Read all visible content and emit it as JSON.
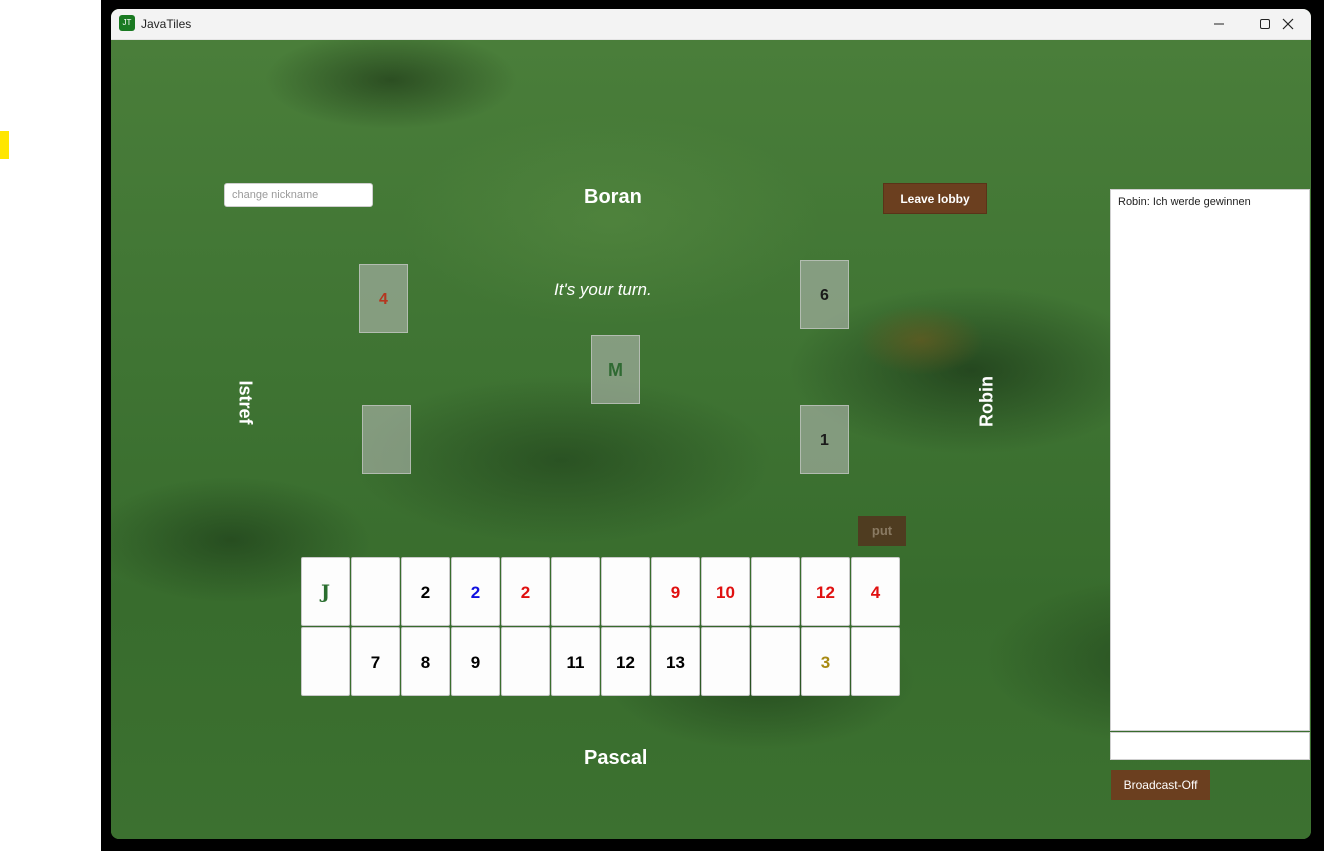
{
  "window": {
    "title": "JavaTiles",
    "icon_text": "JT",
    "icon": "app-icon"
  },
  "controls": {
    "minimize": "minimize-icon",
    "maximize": "maximize-icon",
    "close": "close-icon"
  },
  "lobby": {
    "nickname_placeholder": "change nickname",
    "leave_label": "Leave lobby",
    "turn_message": "It's your turn.",
    "put_label": "put",
    "broadcast_label": "Broadcast-Off"
  },
  "players": {
    "top": "Boran",
    "left": "Istref",
    "right": "Robin",
    "bottom": "Pascal"
  },
  "stacks": {
    "top_left": {
      "value": "4",
      "color": "#b5361f"
    },
    "top_right": {
      "value": "6",
      "color": "#1a1a1a"
    },
    "center": {
      "value": "M",
      "color": "#2f6a32"
    },
    "bottom_left": {
      "value": "",
      "color": "#1a1a1a"
    },
    "bottom_right": {
      "value": "1",
      "color": "#1a1a1a"
    }
  },
  "rack": {
    "row1": [
      {
        "value": "J",
        "color": "#2a6e2f"
      },
      {
        "value": "",
        "color": "#000000"
      },
      {
        "value": "2",
        "color": "#000000"
      },
      {
        "value": "2",
        "color": "#1010e0"
      },
      {
        "value": "2",
        "color": "#e01010"
      },
      {
        "value": "",
        "color": "#000000"
      },
      {
        "value": "",
        "color": "#000000"
      },
      {
        "value": "9",
        "color": "#e01010"
      },
      {
        "value": "10",
        "color": "#e01010"
      },
      {
        "value": "",
        "color": "#000000"
      },
      {
        "value": "12",
        "color": "#e01010"
      },
      {
        "value": "4",
        "color": "#e01010"
      }
    ],
    "row2": [
      {
        "value": "",
        "color": "#000000"
      },
      {
        "value": "7",
        "color": "#000000"
      },
      {
        "value": "8",
        "color": "#000000"
      },
      {
        "value": "9",
        "color": "#000000"
      },
      {
        "value": "",
        "color": "#000000"
      },
      {
        "value": "11",
        "color": "#000000"
      },
      {
        "value": "12",
        "color": "#000000"
      },
      {
        "value": "13",
        "color": "#000000"
      },
      {
        "value": "",
        "color": "#000000"
      },
      {
        "value": "",
        "color": "#000000"
      },
      {
        "value": "3",
        "color": "#a88a12"
      },
      {
        "value": "",
        "color": "#000000"
      }
    ]
  },
  "chat": {
    "messages": [
      "Robin: Ich werde gewinnen"
    ],
    "input_value": ""
  }
}
